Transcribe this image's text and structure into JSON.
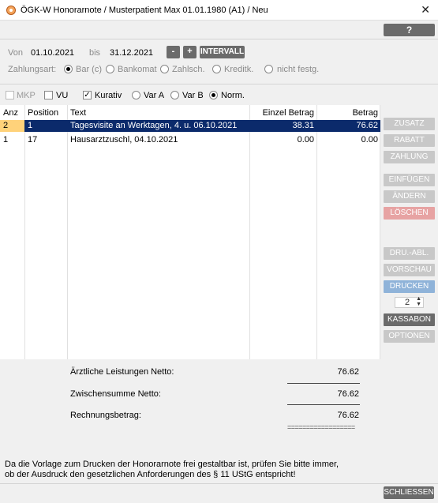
{
  "window": {
    "title": "ÖGK-W Honorarnote / Musterpatient Max 01.01.1980 (A1) / Neu",
    "close_glyph": "✕"
  },
  "help_label": "?",
  "period": {
    "from_label": "Von",
    "from_value": "01.10.2021",
    "to_label": "bis",
    "to_value": "31.12.2021",
    "minus_label": "-",
    "plus_label": "+",
    "interval_label": "INTERVALL"
  },
  "payment": {
    "label": "Zahlungsart:",
    "options": [
      {
        "label": "Bar (c)",
        "selected": true
      },
      {
        "label": "Bankomat",
        "selected": false
      },
      {
        "label": "Zahlsch.",
        "selected": false
      },
      {
        "label": "Kreditk.",
        "selected": false
      },
      {
        "label": "nicht festg.",
        "selected": false
      }
    ]
  },
  "flags": {
    "checkboxes": [
      {
        "label": "MKP",
        "checked": false,
        "enabled": false
      },
      {
        "label": "VU",
        "checked": false,
        "enabled": true
      },
      {
        "label": "Kurativ",
        "checked": true,
        "enabled": true
      }
    ],
    "variants": [
      {
        "label": "Var A",
        "selected": false
      },
      {
        "label": "Var B",
        "selected": false
      },
      {
        "label": "Norm.",
        "selected": true
      }
    ]
  },
  "table": {
    "headers": {
      "anz": "Anz",
      "position": "Position",
      "text": "Text",
      "einzel": "Einzel Betrag",
      "betrag": "Betrag"
    },
    "rows": [
      {
        "anz": "2",
        "position": "1",
        "text": "Tagesvisite an Werktagen, 4. u. 06.10.2021",
        "einzel": "38.31",
        "betrag": "76.62",
        "selected": true
      },
      {
        "anz": "1",
        "position": "17",
        "text": "Hausarztzuschl, 04.10.2021",
        "einzel": "0.00",
        "betrag": "0.00",
        "selected": false
      }
    ]
  },
  "side_buttons": {
    "zusatz": "ZUSATZ",
    "rabatt": "RABATT",
    "zahlung": "ZAHLUNG",
    "einfuegen": "EINFÜGEN",
    "aendern": "ÄNDERN",
    "loeschen": "LÖSCHEN",
    "druabl": "DRU.-ABL.",
    "vorschau": "VORSCHAU",
    "drucken": "DRUCKEN",
    "copies": "2",
    "kassabon": "KASSABON",
    "optionen": "OPTIONEN"
  },
  "summary": {
    "netto_label": "Ärztliche Leistungen Netto:",
    "netto_value": "76.62",
    "zwischen_label": "Zwischensumme Netto:",
    "zwischen_value": "76.62",
    "rechnung_label": "Rechnungsbetrag:",
    "rechnung_value": "76.62",
    "double_line": "=================="
  },
  "footer": {
    "note_line1": "Da die Vorlage zum Drucken der Honorarnote frei gestaltbar ist, prüfen Sie bitte immer,",
    "note_line2": "ob der Ausdruck den gesetzlichen Anforderungen des § 11 UStG entspricht!",
    "close_label": "SCHLIESSEN"
  },
  "colors": {
    "selected_row": "#0b2a6b",
    "selected_anz": "#ffd27a",
    "delete_button": "#e7a3a3",
    "print_button": "#8fb3d9",
    "dark_button": "#6b6b6b"
  }
}
